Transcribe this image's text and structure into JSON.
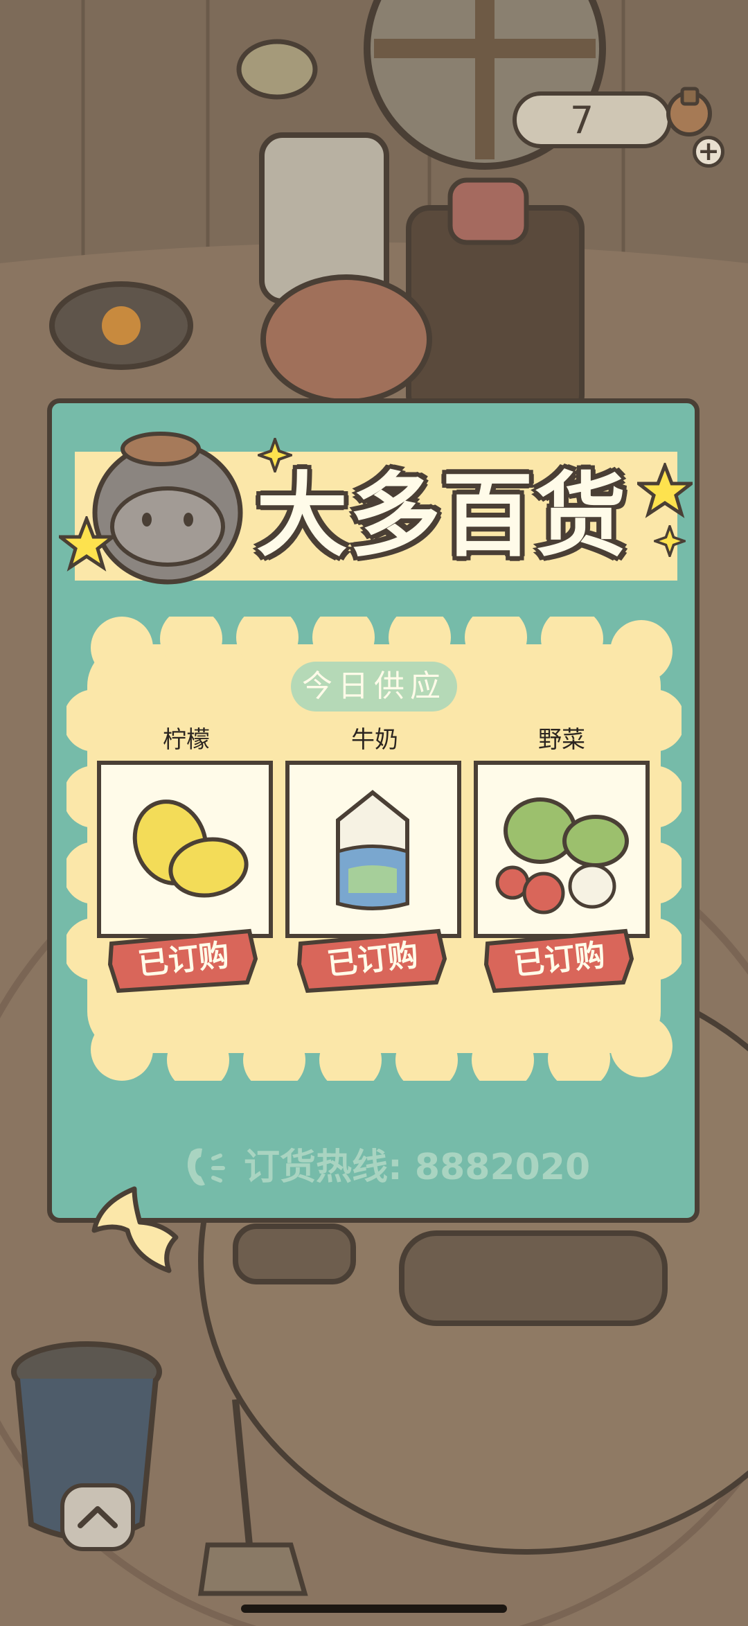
{
  "counter": {
    "value": "7",
    "plus": "+"
  },
  "shop": {
    "name": "大多百货"
  },
  "supply": {
    "title": "今日供应",
    "items": [
      {
        "name": "柠檬",
        "status": "已订购",
        "icon": "lemon-icon"
      },
      {
        "name": "牛奶",
        "status": "已订购",
        "icon": "milk-carton-icon"
      },
      {
        "name": "野菜",
        "status": "已订购",
        "icon": "vegetables-icon"
      }
    ]
  },
  "hotline": {
    "text": "订货热线: 8882020"
  },
  "colors": {
    "board": "#76bba9",
    "banner": "#fbe7a9",
    "outline": "#4a3f35",
    "tag": "#d9665a",
    "background": "#7a6a5a"
  }
}
